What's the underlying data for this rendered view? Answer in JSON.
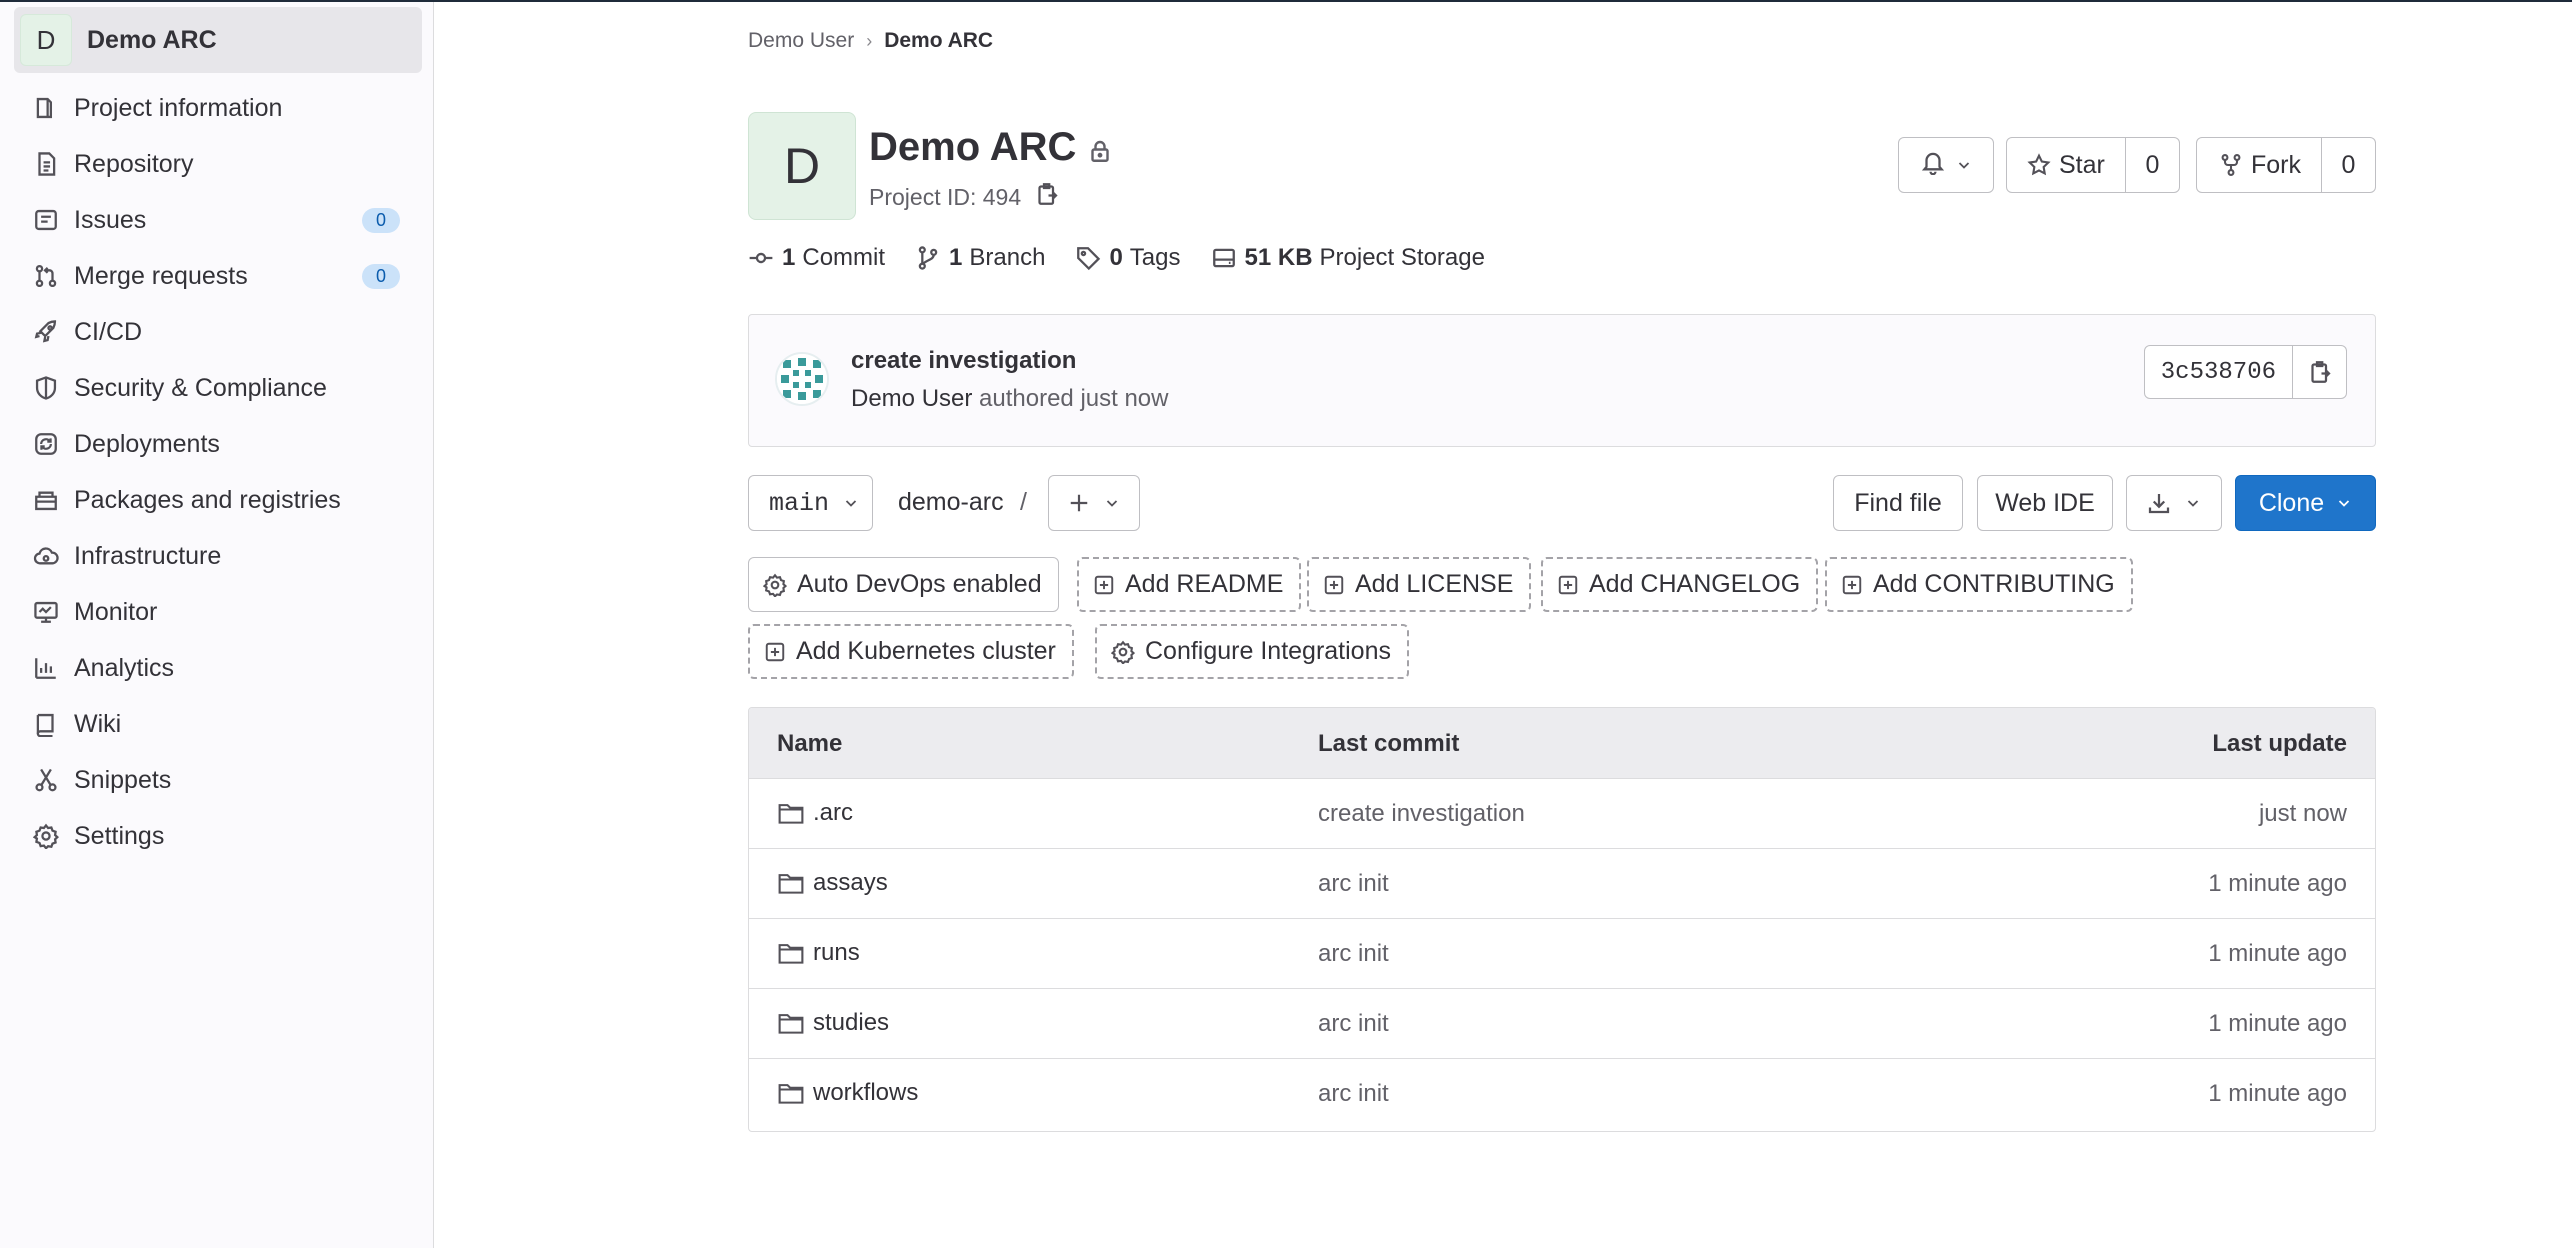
{
  "sidebar": {
    "project_avatar_letter": "D",
    "project_name": "Demo ARC",
    "items": [
      {
        "label": "Project information",
        "icon": "project-info-icon"
      },
      {
        "label": "Repository",
        "icon": "repository-icon"
      },
      {
        "label": "Issues",
        "icon": "issues-icon",
        "count": "0"
      },
      {
        "label": "Merge requests",
        "icon": "merge-request-icon",
        "count": "0"
      },
      {
        "label": "CI/CD",
        "icon": "rocket-icon"
      },
      {
        "label": "Security & Compliance",
        "icon": "shield-icon"
      },
      {
        "label": "Deployments",
        "icon": "deployments-icon"
      },
      {
        "label": "Packages and registries",
        "icon": "package-icon"
      },
      {
        "label": "Infrastructure",
        "icon": "cloud-gear-icon"
      },
      {
        "label": "Monitor",
        "icon": "monitor-icon"
      },
      {
        "label": "Analytics",
        "icon": "chart-icon"
      },
      {
        "label": "Wiki",
        "icon": "book-icon"
      },
      {
        "label": "Snippets",
        "icon": "scissors-icon"
      },
      {
        "label": "Settings",
        "icon": "gear-icon"
      }
    ]
  },
  "breadcrumb": {
    "parent": "Demo User",
    "separator": "›",
    "current": "Demo ARC"
  },
  "project": {
    "avatar_letter": "D",
    "title": "Demo ARC",
    "id_text": "Project ID: 494"
  },
  "actions": {
    "star_label": "Star",
    "star_count": "0",
    "fork_label": "Fork",
    "fork_count": "0"
  },
  "stats": [
    {
      "value": "1",
      "label": "Commit"
    },
    {
      "value": "1",
      "label": "Branch"
    },
    {
      "value": "0",
      "label": "Tags"
    },
    {
      "value": "51 KB",
      "label": "Project Storage"
    }
  ],
  "last_commit": {
    "title": "create investigation",
    "author": "Demo User",
    "meta": "authored just now",
    "sha": "3c538706"
  },
  "repo_toolbar": {
    "branch": "main",
    "path": "demo-arc",
    "path_sep": "/",
    "find_file": "Find file",
    "web_ide": "Web IDE",
    "clone": "Clone"
  },
  "quick_actions": [
    {
      "label": "Auto DevOps enabled",
      "icon": "gear-icon"
    },
    {
      "label": "Add README",
      "icon": "plus-square-icon"
    },
    {
      "label": "Add LICENSE",
      "icon": "plus-square-icon"
    },
    {
      "label": "Add CHANGELOG",
      "icon": "plus-square-icon"
    },
    {
      "label": "Add CONTRIBUTING",
      "icon": "plus-square-icon"
    },
    {
      "label": "Add Kubernetes cluster",
      "icon": "plus-square-icon"
    },
    {
      "label": "Configure Integrations",
      "icon": "gear-icon"
    }
  ],
  "files": {
    "headers": {
      "name": "Name",
      "last_commit": "Last commit",
      "last_update": "Last update"
    },
    "rows": [
      {
        "name": ".arc",
        "commit": "create investigation",
        "updated": "just now"
      },
      {
        "name": "assays",
        "commit": "arc init",
        "updated": "1 minute ago"
      },
      {
        "name": "runs",
        "commit": "arc init",
        "updated": "1 minute ago"
      },
      {
        "name": "studies",
        "commit": "arc init",
        "updated": "1 minute ago"
      },
      {
        "name": "workflows",
        "commit": "arc init",
        "updated": "1 minute ago"
      }
    ]
  },
  "colors": {
    "primary": "#1f75cb",
    "badge_bg": "#cbe2f9",
    "avatar_bg": "#e4f2e7"
  }
}
